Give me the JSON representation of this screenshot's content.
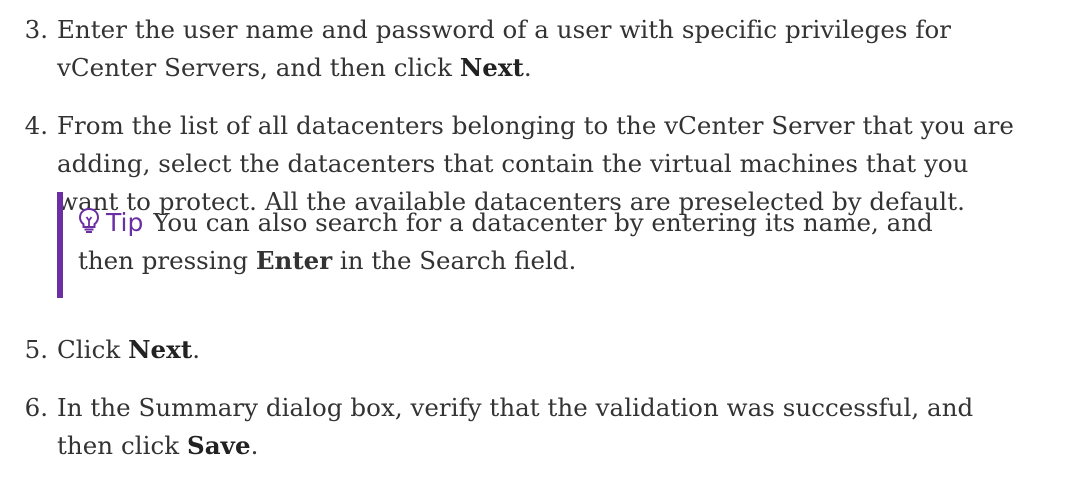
{
  "steps": [
    {
      "number": "3.",
      "line1_text": "Enter the user name and password of a user with specific privileges for",
      "line2_text": "vCenter Servers, and then click ",
      "line2_bold": "Next",
      "line2_end": "."
    },
    {
      "number": "4.",
      "line1_text": "From the list of all datacenters belonging to the vCenter Server that you are",
      "line2_text": "adding, select the datacenters that contain the virtual machines that you",
      "line3_text": "want to protect. All the available datacenters are preselected by default."
    },
    {
      "number": "5.",
      "text": "Click ",
      "bold": "Next",
      "end": "."
    },
    {
      "number": "6.",
      "line1_text": "In the Summary dialog box, verify that the validation was successful, and",
      "line2_text": "then click ",
      "line2_bold": "Save",
      "line2_end": "."
    }
  ],
  "tip": {
    "icon": "lightbulb-icon",
    "label": "Tip",
    "line1_text": "You can also search for a datacenter by entering its name, and",
    "line2_text": "then pressing ",
    "line2_bold": "Enter",
    "line2_end": " in the Search field.",
    "accent_color": "#6b2fa3"
  }
}
